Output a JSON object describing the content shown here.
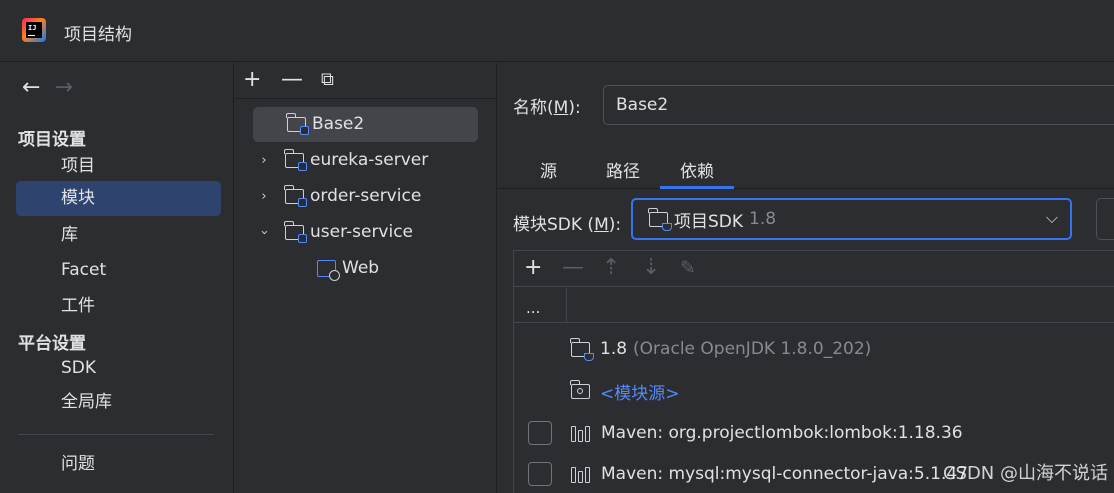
{
  "window": {
    "title": "项目结构"
  },
  "nav": {
    "back": "←",
    "forward": "→",
    "section_project": "项目设置",
    "section_platform": "平台设置",
    "items": [
      {
        "label": "项目"
      },
      {
        "label": "模块"
      },
      {
        "label": "库"
      },
      {
        "label": "Facet"
      },
      {
        "label": "工件"
      },
      {
        "label": "SDK"
      },
      {
        "label": "全局库"
      },
      {
        "label": "问题"
      }
    ]
  },
  "tree": {
    "toolbar": {
      "add": "+",
      "remove": "—",
      "copy": "⧉"
    },
    "nodes": [
      {
        "label": "Base2"
      },
      {
        "label": "eureka-server"
      },
      {
        "label": "order-service"
      },
      {
        "label": "user-service"
      },
      {
        "label": "Web"
      }
    ]
  },
  "main": {
    "name_label_prefix": "名称(",
    "name_label_key": "M",
    "name_label_suffix": "):",
    "name_value": "Base2",
    "tabs": [
      {
        "label": "源"
      },
      {
        "label": "路径"
      },
      {
        "label": "依赖"
      }
    ],
    "sdk_label_prefix": "模块SDK (",
    "sdk_label_key": "M",
    "sdk_label_suffix": "):",
    "sdk_name": "项目SDK",
    "sdk_version": "1.8",
    "dep_toolbar": {
      "add": "+",
      "remove": "—",
      "up": "⇡",
      "down": "⇣",
      "edit": "✎"
    },
    "dep_header_col1": "...",
    "deps": [
      {
        "name": "1.8",
        "detail": "(Oracle OpenJDK 1.8.0_202)"
      },
      {
        "name": "<模块源>"
      },
      {
        "name": "Maven: org.projectlombok:lombok:1.18.36"
      },
      {
        "name": "Maven: mysql:mysql-connector-java:5.1.47"
      }
    ]
  },
  "watermark": "CSDN @山海不说话"
}
